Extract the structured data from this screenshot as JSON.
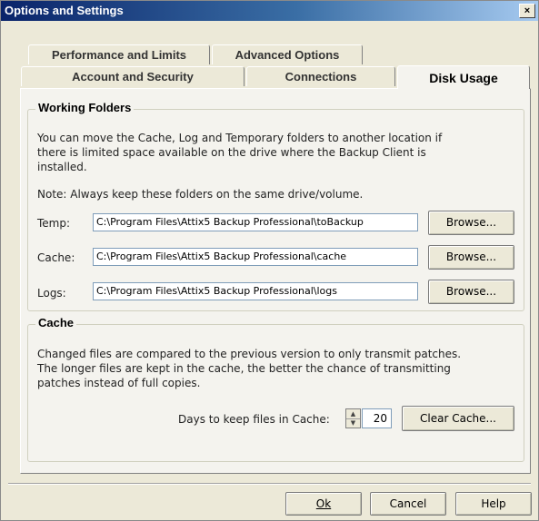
{
  "window": {
    "title": "Options and Settings",
    "close_glyph": "×"
  },
  "tabs": {
    "row1": [
      {
        "label": "Performance and Limits"
      },
      {
        "label": "Advanced Options"
      }
    ],
    "row2": [
      {
        "label": "Account and Security"
      },
      {
        "label": "Connections"
      },
      {
        "label": "Disk Usage",
        "active": true
      }
    ]
  },
  "working_folders": {
    "legend": "Working Folders",
    "description": "You can move the Cache, Log and Temporary folders to another location if there is limited space available on the drive where the Backup Client is installed.",
    "note": "Note: Always keep these folders on the same drive/volume.",
    "rows": [
      {
        "label": "Temp:",
        "value": "C:\\Program Files\\Attix5 Backup Professional\\toBackup",
        "button": "Browse..."
      },
      {
        "label": "Cache:",
        "value": "C:\\Program Files\\Attix5 Backup Professional\\cache",
        "button": "Browse..."
      },
      {
        "label": "Logs:",
        "value": "C:\\Program Files\\Attix5 Backup Professional\\logs",
        "button": "Browse..."
      }
    ]
  },
  "cache": {
    "legend": "Cache",
    "description": "Changed files are compared to the previous version to only transmit patches. The longer files are kept in the cache, the better the chance of transmitting patches instead of full copies.",
    "days_label": "Days to keep files in Cache:",
    "days_value": "20",
    "clear_button": "Clear Cache..."
  },
  "footer": {
    "ok": "Ok",
    "cancel": "Cancel",
    "help": "Help"
  }
}
